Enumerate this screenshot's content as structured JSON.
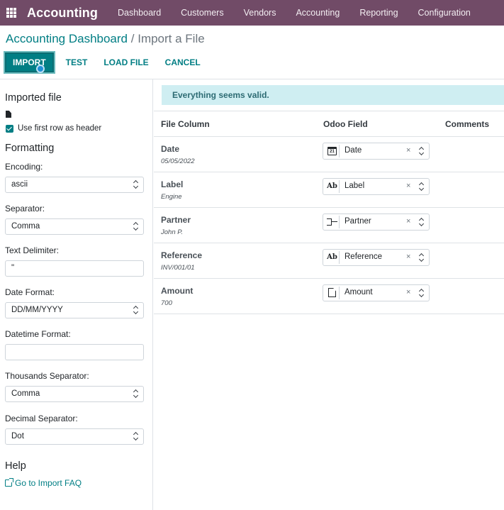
{
  "navbar": {
    "brand": "Accounting",
    "menu": [
      "Dashboard",
      "Customers",
      "Vendors",
      "Accounting",
      "Reporting",
      "Configuration"
    ]
  },
  "breadcrumb": {
    "parent": "Accounting Dashboard",
    "separator": "/",
    "current": "Import a File"
  },
  "actions": {
    "import": "IMPORT",
    "test": "TEST",
    "load_file": "LOAD FILE",
    "cancel": "CANCEL"
  },
  "sidebar": {
    "imported_file_heading": "Imported file",
    "file_icon": "file-icon",
    "use_header_label": "Use first row as header",
    "use_header_checked": true,
    "formatting_heading": "Formatting",
    "encoding_label": "Encoding:",
    "encoding_value": "ascii",
    "separator_label": "Separator:",
    "separator_value": "Comma",
    "text_delimiter_label": "Text Delimiter:",
    "text_delimiter_value": "\"",
    "date_format_label": "Date Format:",
    "date_format_value": "DD/MM/YYYY",
    "datetime_format_label": "Datetime Format:",
    "datetime_format_value": "",
    "thousands_separator_label": "Thousands Separator:",
    "thousands_separator_value": "Comma",
    "decimal_separator_label": "Decimal Separator:",
    "decimal_separator_value": "Dot",
    "help_heading": "Help",
    "faq_link": "Go to Import FAQ"
  },
  "main": {
    "alert": "Everything seems valid.",
    "columns": {
      "file_column": "File Column",
      "odoo_field": "Odoo Field",
      "comments": "Comments"
    },
    "rows": [
      {
        "name": "Date",
        "sample": "05/05/2022",
        "field": "Date",
        "icon": "calendar-icon",
        "icon_text": "21"
      },
      {
        "name": "Label",
        "sample": "Engine",
        "field": "Label",
        "icon": "text-icon",
        "icon_text": "Ab"
      },
      {
        "name": "Partner",
        "sample": "John P.",
        "field": "Partner",
        "icon": "relation-icon",
        "icon_text": ""
      },
      {
        "name": "Reference",
        "sample": "INV/001/01",
        "field": "Reference",
        "icon": "text-icon",
        "icon_text": "Ab"
      },
      {
        "name": "Amount",
        "sample": "700",
        "field": "Amount",
        "icon": "document-icon",
        "icon_text": ""
      }
    ],
    "clear_glyph": "×"
  },
  "colors": {
    "navbar": "#714b67",
    "primary": "#017e84",
    "alert_bg": "#cfeef2"
  }
}
